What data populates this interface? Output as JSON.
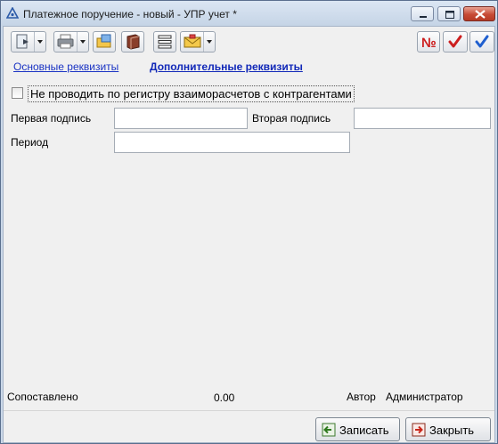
{
  "window": {
    "title": "Платежное поручение - новый - УПР учет *"
  },
  "toolbar": {
    "icons": [
      "document-icon",
      "print-icon",
      "open-folder-icon",
      "book-icon",
      "list-icon",
      "envelope-icon",
      "number-icon",
      "check-red-icon",
      "check-blue-icon"
    ],
    "number_label": "№"
  },
  "tabs": [
    {
      "label": "Основные реквизиты",
      "active": false
    },
    {
      "label": "Дополнительные реквизиты",
      "active": true
    }
  ],
  "form": {
    "checkbox_label": "Не проводить по регистру взаиморасчетов с контрагентами",
    "checkbox_checked": false,
    "first_signature_label": "Первая подпись",
    "first_signature_value": "",
    "second_signature_label": "Вторая подпись",
    "second_signature_value": "",
    "period_label": "Период",
    "period_value": ""
  },
  "footer": {
    "matched_label": "Сопоставлено",
    "matched_value": "0.00",
    "author_label": "Автор",
    "author_value": "Администратор"
  },
  "buttons": {
    "save_label": "Записать",
    "close_label": "Закрыть"
  },
  "colors": {
    "link": "#1a33c4",
    "close_button": "#c74b35",
    "check_red": "#cc1e1e",
    "check_blue": "#1f5fcf"
  }
}
